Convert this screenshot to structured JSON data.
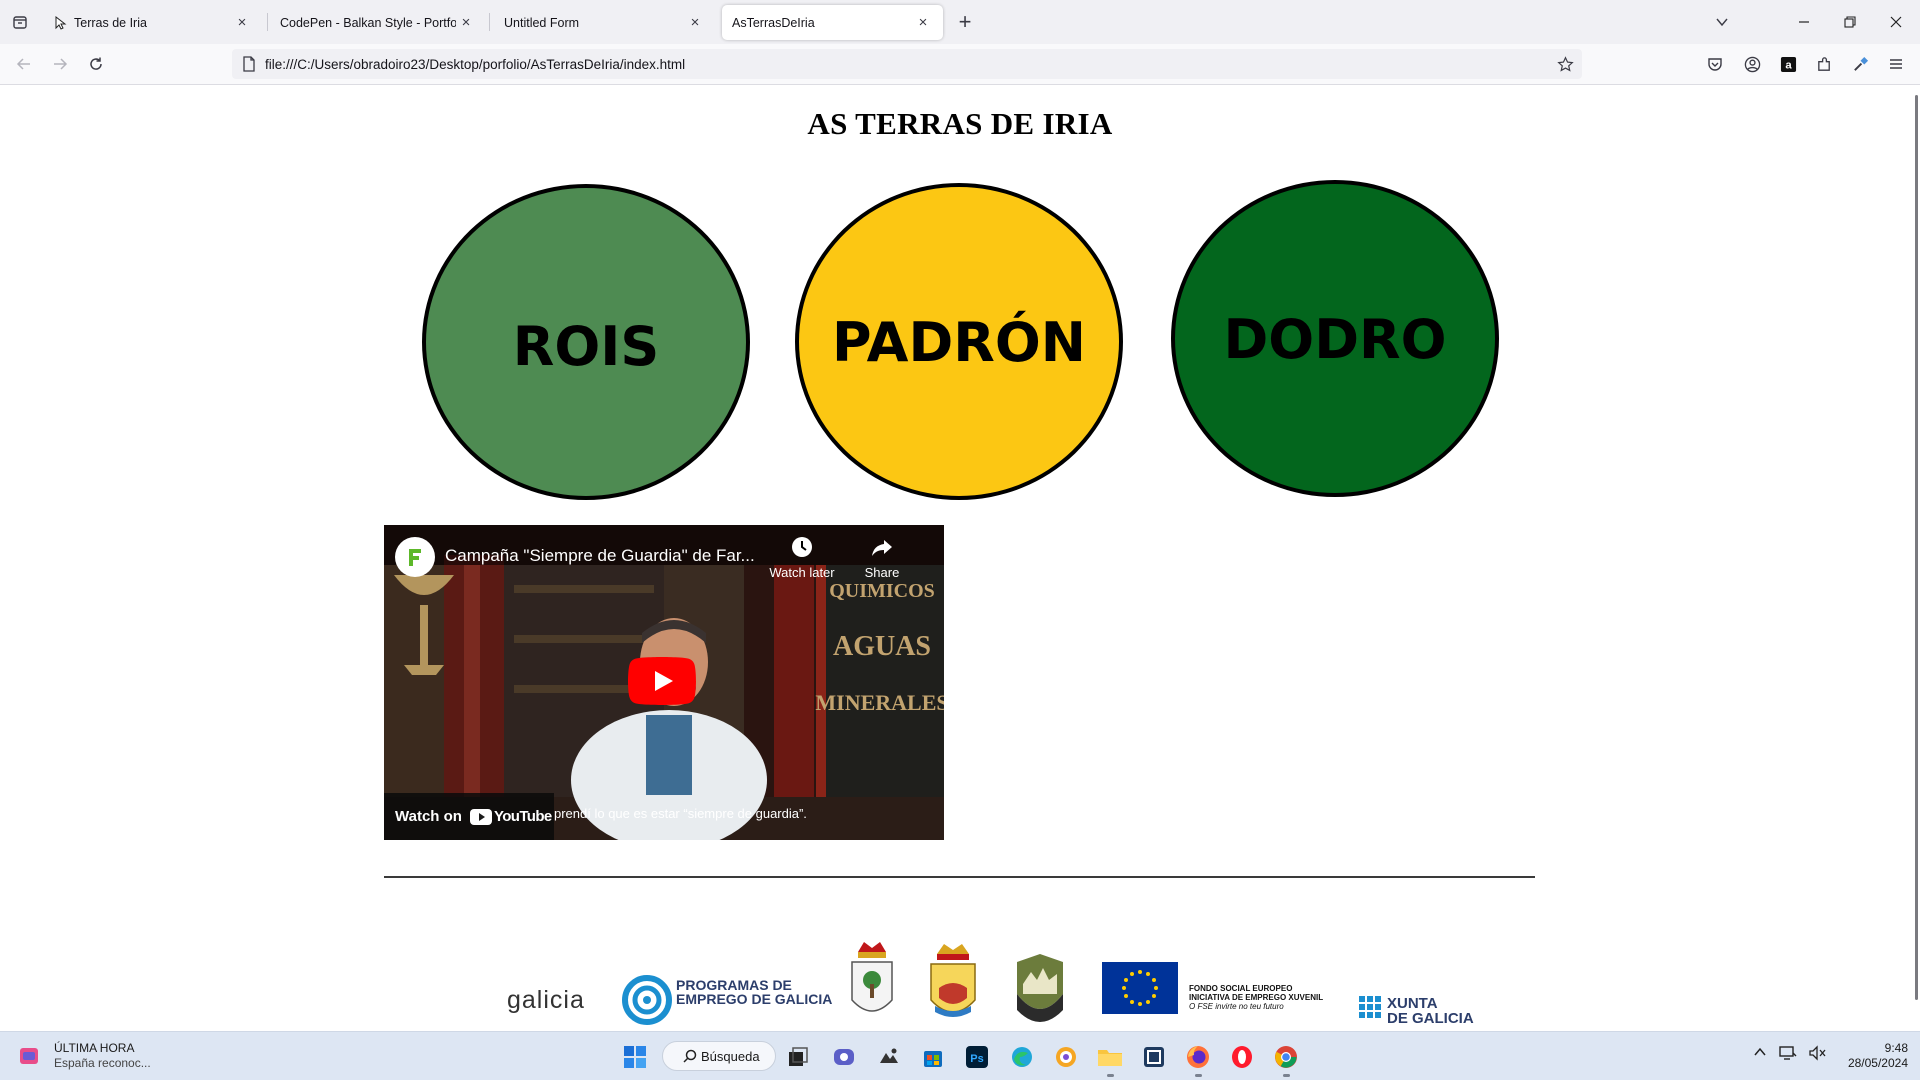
{
  "browser": {
    "tabs": [
      {
        "title": "Terras de Iria",
        "active": false
      },
      {
        "title": "CodePen - Balkan Style - Portfolio",
        "active": false
      },
      {
        "title": "Untitled Form",
        "active": false
      },
      {
        "title": "AsTerrasDeIria",
        "active": true
      }
    ],
    "new_tab_symbol": "+",
    "url": "file:///C:/Users/obradoiro23/Desktop/porfolio/AsTerrasDeIria/index.html",
    "icons": [
      "tab-list-icon",
      "back-icon",
      "forward-icon",
      "reload-icon",
      "page-info-icon",
      "bookmark-star-icon",
      "pocket-icon",
      "account-icon",
      "amazon-icon",
      "extensions-icon",
      "eyedropper-icon",
      "menu-icon",
      "minimize-icon",
      "maximize-icon",
      "close-icon"
    ]
  },
  "page": {
    "title": "AS TERRAS DE IRIA",
    "regions": [
      {
        "label": "ROIS",
        "color": "#4e8b52"
      },
      {
        "label": "PADRÓN",
        "color": "#fcc713"
      },
      {
        "label": "DODRO",
        "color": "#03661d"
      }
    ],
    "video": {
      "title": "Campaña \"Siempre de Guardia\" de Far...",
      "watch_later": "Watch later",
      "share": "Share",
      "watch_on": "Watch on",
      "youtube": "YouTube",
      "caption": "prendí lo que es estar “siempre de guardia”.",
      "scene_words": [
        "QUIMICOS",
        "AGUAS",
        "MINERALES"
      ]
    },
    "footer_logos": {
      "galicia": "galicia",
      "programas_line1": "PROGRAMAS DE",
      "programas_line2": "EMPREGO DE GALICIA",
      "fse_line1": "FONDO SOCIAL EUROPEO",
      "fse_line2": "INICIATIVA DE EMPREGO XUVENIL",
      "fse_line3": "O FSE invirte no teu futuro",
      "xunta_line1": "XUNTA",
      "xunta_line2": "DE GALICIA"
    }
  },
  "taskbar": {
    "news_title": "ÚLTIMA HORA",
    "news_subtitle": "España reconoc...",
    "search_label": "Búsqueda",
    "apps": [
      "start-icon",
      "search-icon",
      "task-view-icon",
      "teams-icon",
      "photos-icon",
      "store-icon",
      "photoshop-icon",
      "edge-icon",
      "vpn-icon",
      "file-explorer-icon",
      "devtools-icon",
      "firefox-icon",
      "opera-icon",
      "chrome-icon"
    ],
    "photoshop_label": "Ps",
    "time": "9:48",
    "date": "28/05/2024"
  }
}
